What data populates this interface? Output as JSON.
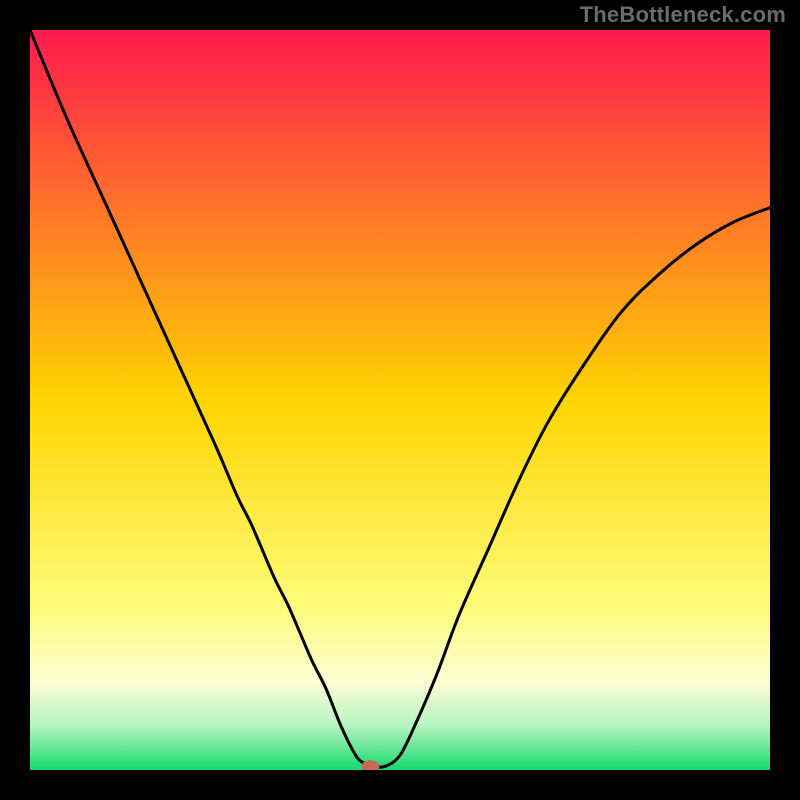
{
  "watermark": "TheBottleneck.com",
  "chart_data": {
    "type": "line",
    "title": "",
    "xlabel": "",
    "ylabel": "",
    "xlim": [
      0,
      100
    ],
    "ylim": [
      0,
      100
    ],
    "series": [
      {
        "name": "curve",
        "x": [
          0,
          5,
          10,
          15,
          20,
          25,
          28,
          30,
          33,
          35,
          38,
          40,
          42,
          44,
          45,
          46,
          48,
          50,
          52,
          55,
          58,
          62,
          66,
          70,
          75,
          80,
          85,
          90,
          95,
          100
        ],
        "y": [
          100,
          88,
          77,
          66,
          55,
          44,
          37,
          33,
          26,
          22,
          15,
          11,
          6,
          2,
          1,
          0.5,
          0.5,
          2,
          6,
          13,
          21,
          30,
          39,
          47,
          55,
          62,
          67,
          71,
          74,
          76
        ],
        "color": "#000000"
      }
    ],
    "marker": {
      "x": 46,
      "y": 0.5,
      "color": "#c66a5b"
    },
    "background_gradient": {
      "stops": [
        {
          "offset": 0.0,
          "color": "#ff1a4e"
        },
        {
          "offset": 0.5,
          "color": "#ffd400"
        },
        {
          "offset": 0.78,
          "color": "#fefc7a"
        },
        {
          "offset": 0.88,
          "color": "#fcfdd2"
        },
        {
          "offset": 0.94,
          "color": "#b6f4c2"
        },
        {
          "offset": 1.0,
          "color": "#17da6d"
        }
      ]
    }
  }
}
